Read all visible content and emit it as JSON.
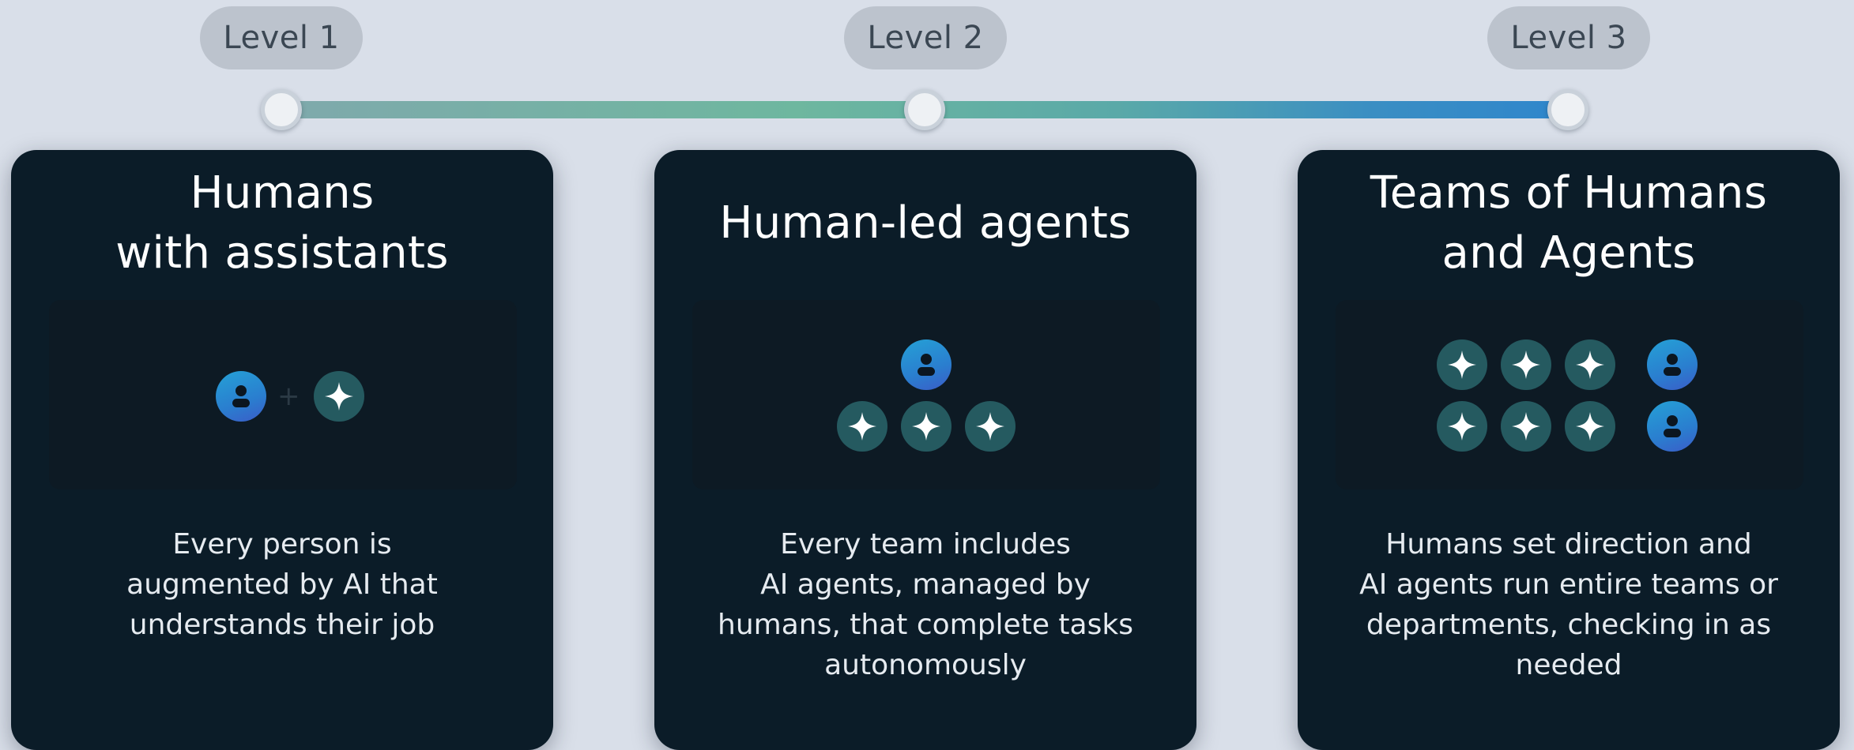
{
  "levels": [
    {
      "pill": "Level 1",
      "title": "Humans\nwith assistants",
      "description": "Every person is\naugmented by AI that\nunderstands their job"
    },
    {
      "pill": "Level 2",
      "title": "Human-led agents",
      "description": "Every team includes\nAI agents, managed by\nhumans, that complete tasks\nautonomously"
    },
    {
      "pill": "Level 3",
      "title": "Teams of Humans\nand Agents",
      "description": "Humans set direction and\nAI agents run entire teams or\ndepartments, checking in as\nneeded"
    }
  ],
  "connector_glyph": "+",
  "icons": {
    "human": "person-icon",
    "ai": "ai-sparkle-icon"
  },
  "colors": {
    "background": "#d9dfe9",
    "card": "#0b1c28",
    "human_icon": "#2a7ecf",
    "ai_icon": "#255a60",
    "track_start": "#7fa9ac",
    "track_end": "#2f86cc"
  }
}
